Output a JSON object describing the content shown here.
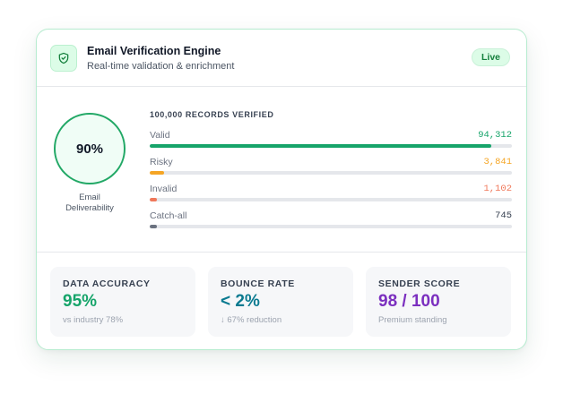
{
  "header": {
    "title": "Email Verification Engine",
    "subtitle": "Real-time validation & enrichment",
    "badge": "Live",
    "icon": "shield-check-icon"
  },
  "deliverability": {
    "value": "90%",
    "fraction": 0.9,
    "label_line1": "Email",
    "label_line2": "Deliverability"
  },
  "records": {
    "heading": "100,000 RECORDS VERIFIED",
    "total": 100000,
    "rows": [
      {
        "label": "Valid",
        "count": "94,312",
        "value": 94312,
        "color": "#16a46a"
      },
      {
        "label": "Risky",
        "count": "3,841",
        "value": 3841,
        "color": "#f5a524"
      },
      {
        "label": "Invalid",
        "count": "1,102",
        "value": 1102,
        "color": "#f0785a"
      },
      {
        "label": "Catch-all",
        "count": "745",
        "value": 745,
        "color": "#6b7280"
      }
    ]
  },
  "stats": [
    {
      "label": "DATA ACCURACY",
      "value": "95%",
      "note": "vs industry 78%",
      "color": "#16a46a"
    },
    {
      "label": "BOUNCE RATE",
      "value": "< 2%",
      "note": "↓ 67% reduction",
      "color": "#0a7a90"
    },
    {
      "label": "SENDER SCORE",
      "value": "98 / 100",
      "note": "Premium standing",
      "color": "#7b2fbf"
    }
  ],
  "colors": {
    "accent": "#22a866",
    "border": "#b7ecd0",
    "badge_bg": "#dcfce7",
    "badge_text": "#15803d"
  }
}
